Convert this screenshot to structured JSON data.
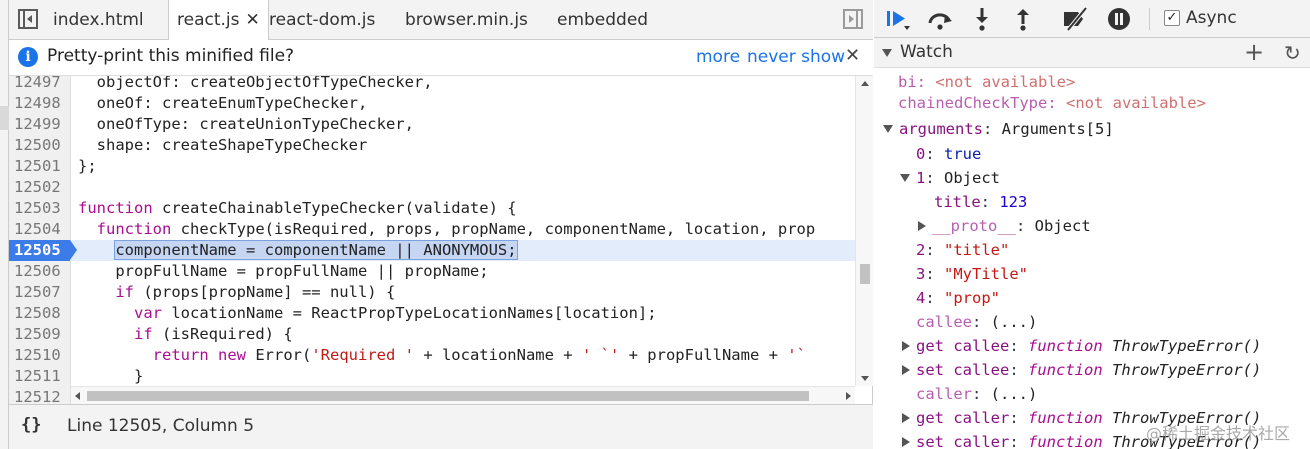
{
  "tabs": [
    {
      "label": "index.html",
      "active": false
    },
    {
      "label": "react.js",
      "active": true
    },
    {
      "label": "react-dom.js",
      "active": false
    },
    {
      "label": "browser.min.js",
      "active": false
    },
    {
      "label": "embedded",
      "active": false
    }
  ],
  "tab_close_glyph": "✕",
  "infobar": {
    "icon": "i",
    "message": "Pretty-print this minified file?",
    "more": "more",
    "never_show": "never show",
    "close": "✕"
  },
  "code": {
    "line_numbers": [
      "12497",
      "12498",
      "12499",
      "12500",
      "12501",
      "12502",
      "12503",
      "12504",
      "12505",
      "12506",
      "12507",
      "12508",
      "12509",
      "12510",
      "12511",
      "12512"
    ],
    "current_line": "12505",
    "lines": [
      [
        "  objectOf: createObjectOfTypeChecker,"
      ],
      [
        "  oneOf: createEnumTypeChecker,"
      ],
      [
        "  oneOfType: createUnionTypeChecker,"
      ],
      [
        "  shape: createShapeTypeChecker"
      ],
      [
        "};"
      ],
      [
        ""
      ],
      [
        "function",
        " createChainableTypeChecker(validate) {"
      ],
      [
        "  ",
        "function",
        " checkType(isRequired, props, propName, componentName, location, prop"
      ],
      [
        "    ",
        "componentName = componentName || ANONYMOUS;"
      ],
      [
        "    propFullName = propFullName || propName;"
      ],
      [
        "    ",
        "if",
        " (props[propName] == null) {"
      ],
      [
        "      ",
        "var",
        " locationName = ReactPropTypeLocationNames[location];"
      ],
      [
        "      ",
        "if",
        " (isRequired) {"
      ],
      [
        "        ",
        "return",
        " ",
        "new",
        " Error(",
        "'Required '",
        " + locationName + ",
        "' `'",
        " + propFullName + ",
        "'`"
      ],
      [
        "      }"
      ],
      [
        ""
      ]
    ]
  },
  "status": {
    "pretty_print": "{}",
    "position": "Line 12505, Column 5"
  },
  "toolbar": {
    "async_label": "Async",
    "async_checked": "✓"
  },
  "watch": {
    "title": "Watch",
    "add": "+",
    "refresh": "↻"
  },
  "tree": {
    "bi_key": "bi",
    "bi_val": "<not available>",
    "cct_key": "chainedCheckType",
    "cct_val": "<not available>",
    "arguments_key": "arguments",
    "arguments_val": "Arguments[5]",
    "a0_key": "0",
    "a0_val": "true",
    "a1_key": "1",
    "a1_val": "Object",
    "title_key": "title",
    "title_val": "123",
    "proto_key": "__proto__",
    "proto_val": "Object",
    "a2_key": "2",
    "a2_val": "\"title\"",
    "a3_key": "3",
    "a3_val": "\"MyTitle\"",
    "a4_key": "4",
    "a4_val": "\"prop\"",
    "callee_key": "callee",
    "callee_val": "(...)",
    "get_callee_key": "get callee",
    "set_callee_key": "set callee",
    "caller_key": "caller",
    "caller_val": "(...)",
    "get_caller_key": "get caller",
    "set_caller_key": "set caller",
    "fn_kw": "function",
    "fn_name": "ThrowTypeError()"
  },
  "watermark": "@稀土掘金技术社区"
}
